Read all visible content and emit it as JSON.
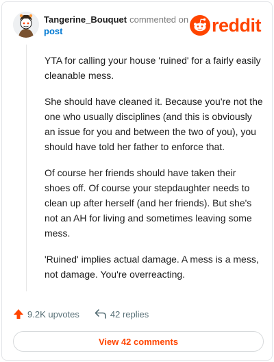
{
  "header": {
    "author": "Tangerine_Bouquet",
    "commented_on": "commented on",
    "post_link": "post",
    "brand": "reddit",
    "avatar_icon": "snoo-avatar-icon",
    "brand_color": "#ff4500"
  },
  "comment": {
    "paragraphs": [
      "YTA for calling your house 'ruined' for a fairly easily cleanable mess.",
      "She should have cleaned it. Because you're not the one who usually disciplines (and this is obviously an issue for you and between the two of you), you should have told her father to enforce that.",
      "Of course her friends should have taken their shoes off. Of course your stepdaughter needs to clean up after herself (and her friends). But she's not an AH for living and sometimes leaving some mess.",
      "'Ruined' implies actual damage. A mess is a mess, not damage. You're overreacting."
    ]
  },
  "actions": {
    "upvotes": "9.2K upvotes",
    "replies": "42 replies",
    "upvote_icon": "upvote-arrow-icon",
    "reply_icon": "reply-arrow-icon"
  },
  "footer": {
    "view_comments": "View 42 comments"
  }
}
